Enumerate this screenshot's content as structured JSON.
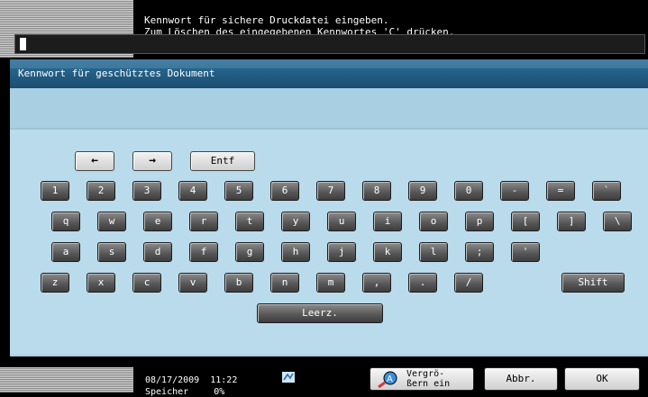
{
  "message": {
    "line1": "Kennwort für sichere Druckdatei eingeben.",
    "line2": "Zum Löschen des eingegebenen Kennwortes 'C' drücken."
  },
  "dialog": {
    "title": "Kennwort für geschütztes Dokument",
    "password_value": ""
  },
  "keyboard": {
    "nav": [
      "←",
      "→",
      "Entf"
    ],
    "row1": [
      "1",
      "2",
      "3",
      "4",
      "5",
      "6",
      "7",
      "8",
      "9",
      "0",
      "-",
      "=",
      "`"
    ],
    "row2": [
      "q",
      "w",
      "e",
      "r",
      "t",
      "y",
      "u",
      "i",
      "o",
      "p",
      "[",
      "]",
      "\\"
    ],
    "row3": [
      "a",
      "s",
      "d",
      "f",
      "g",
      "h",
      "j",
      "k",
      "l",
      ";",
      "'"
    ],
    "row4": [
      "z",
      "x",
      "c",
      "v",
      "b",
      "n",
      "m",
      ",",
      ".",
      "/"
    ],
    "shift": "Shift",
    "space": "Leerz."
  },
  "status": {
    "date": "08/17/2009",
    "time": "11:22",
    "memory_label": "Speicher",
    "memory_value": "0%",
    "zoom_label_1": "Vergrö-",
    "zoom_label_2": "ßern ein",
    "cancel": "Abbr.",
    "ok": "OK"
  }
}
